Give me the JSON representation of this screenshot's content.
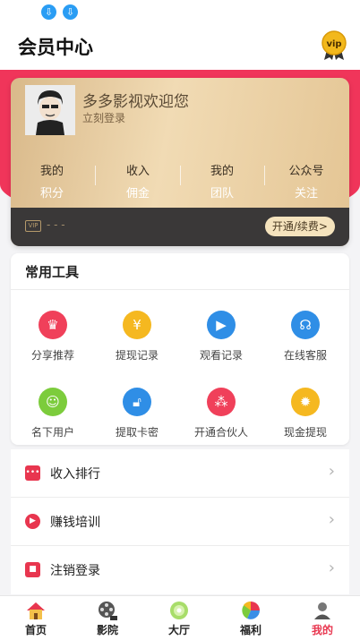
{
  "status_bar": {
    "icons": [
      "download-icon",
      "download-icon"
    ]
  },
  "header": {
    "title": "会员中心",
    "vip_badge_text": "vip"
  },
  "member_card": {
    "welcome": "多多影视欢迎您",
    "login_link": "立刻登录",
    "stats": [
      {
        "top": "我的",
        "bottom": "积分"
      },
      {
        "top": "收入",
        "bottom": "佣金"
      },
      {
        "top": "我的",
        "bottom": "团队"
      },
      {
        "top": "公众号",
        "bottom": "关注"
      }
    ],
    "vip_icon_text": "VIP",
    "vip_status": "- - -",
    "renew_label": "开通/续费>"
  },
  "tools": {
    "title": "常用工具",
    "items": [
      {
        "label": "分享推荐",
        "icon": "crown-icon",
        "color": "#f0405a"
      },
      {
        "label": "提现记录",
        "icon": "coins-icon",
        "color": "#f5b820"
      },
      {
        "label": "观看记录",
        "icon": "screen-icon",
        "color": "#2f8ee6"
      },
      {
        "label": "在线客服",
        "icon": "headset-icon",
        "color": "#2f8ee6"
      },
      {
        "label": "名下用户",
        "icon": "contact-icon",
        "color": "#7ccc3c"
      },
      {
        "label": "提取卡密",
        "icon": "lock-icon",
        "color": "#2f8ee6"
      },
      {
        "label": "开通合伙人",
        "icon": "network-icon",
        "color": "#f0405a"
      },
      {
        "label": "现金提现",
        "icon": "gear-coin-icon",
        "color": "#f5b820"
      }
    ]
  },
  "menu": {
    "items": [
      {
        "label": "收入排行",
        "icon": "chat-icon"
      },
      {
        "label": "赚钱培训",
        "icon": "play-icon"
      },
      {
        "label": "注销登录",
        "icon": "lock-icon"
      }
    ]
  },
  "tab_bar": {
    "tabs": [
      {
        "label": "首页",
        "icon": "home-icon",
        "active": false
      },
      {
        "label": "影院",
        "icon": "film-reel-icon",
        "active": false
      },
      {
        "label": "大厅",
        "icon": "disc-icon",
        "active": false
      },
      {
        "label": "福利",
        "icon": "pie-chart-icon",
        "active": false
      },
      {
        "label": "我的",
        "icon": "user-icon",
        "active": true
      }
    ]
  },
  "colors": {
    "brand_red": "#f0355a",
    "card_gold": "#e4c594",
    "active_tab": "#e8364f"
  }
}
